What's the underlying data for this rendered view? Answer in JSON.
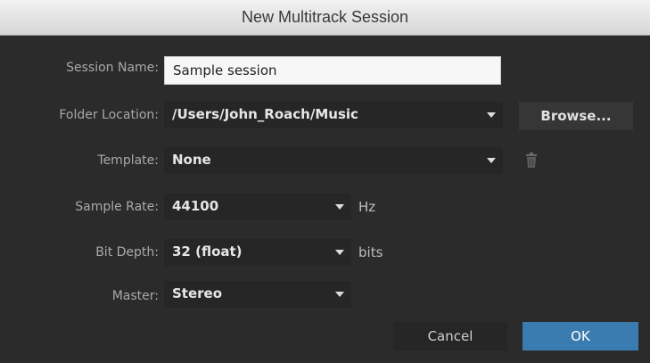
{
  "dialog": {
    "title": "New Multitrack Session"
  },
  "fields": {
    "session_name": {
      "label": "Session Name:",
      "value": "Sample session"
    },
    "folder_location": {
      "label": "Folder Location:",
      "value": "/Users/John_Roach/Music"
    },
    "template": {
      "label": "Template:",
      "value": "None"
    },
    "sample_rate": {
      "label": "Sample Rate:",
      "value": "44100",
      "unit": "Hz"
    },
    "bit_depth": {
      "label": "Bit Depth:",
      "value": "32 (float)",
      "unit": "bits"
    },
    "master": {
      "label": "Master:",
      "value": "Stereo"
    }
  },
  "buttons": {
    "browse": "Browse...",
    "cancel": "Cancel",
    "ok": "OK"
  },
  "icons": {
    "trash": "trash-icon",
    "dropdown": "chevron-down-icon"
  },
  "colors": {
    "background": "#2b2b2b",
    "field_dark": "#262626",
    "ok_button": "#3a7cb0",
    "titlebar": "#e4e4e4"
  }
}
